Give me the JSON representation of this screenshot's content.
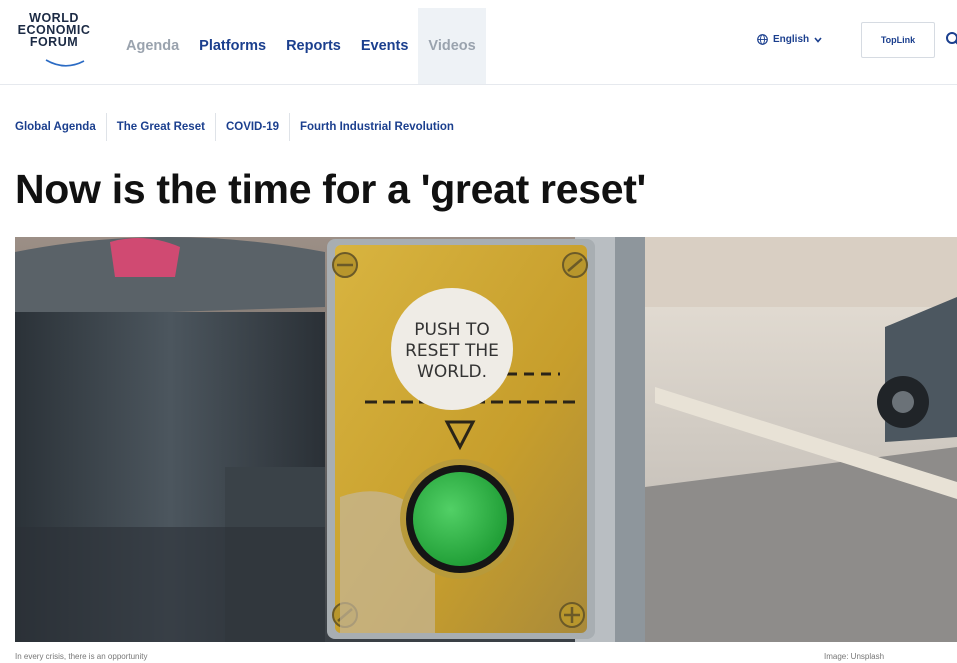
{
  "brand": {
    "line1": "WORLD",
    "line2": "ECONOMIC",
    "line3": "FORUM"
  },
  "nav": {
    "items": [
      "Agenda",
      "Platforms",
      "Reports",
      "Events",
      "Videos"
    ]
  },
  "header": {
    "language": "English",
    "toplink": "TopLink"
  },
  "topics": [
    "Global Agenda",
    "The Great Reset",
    "COVID-19",
    "Fourth Industrial Revolution"
  ],
  "article": {
    "title": "Now is the time for a 'great reset'",
    "caption": "In every crisis, there is an opportunity",
    "credit": "Image: Unsplash"
  },
  "image": {
    "sticker_line1": "PUSH TO",
    "sticker_line2": "RESET THE",
    "sticker_line3": "WORLD.",
    "button_color": "#2fb84a",
    "plate_color": "#c9a433"
  },
  "colors": {
    "brand_blue": "#1b3f8e",
    "muted": "#9aa3ae",
    "active_bg": "#eef2f6"
  },
  "icons": {
    "language": "globe-icon",
    "chevron": "chevron-down-icon",
    "search": "search-icon"
  }
}
